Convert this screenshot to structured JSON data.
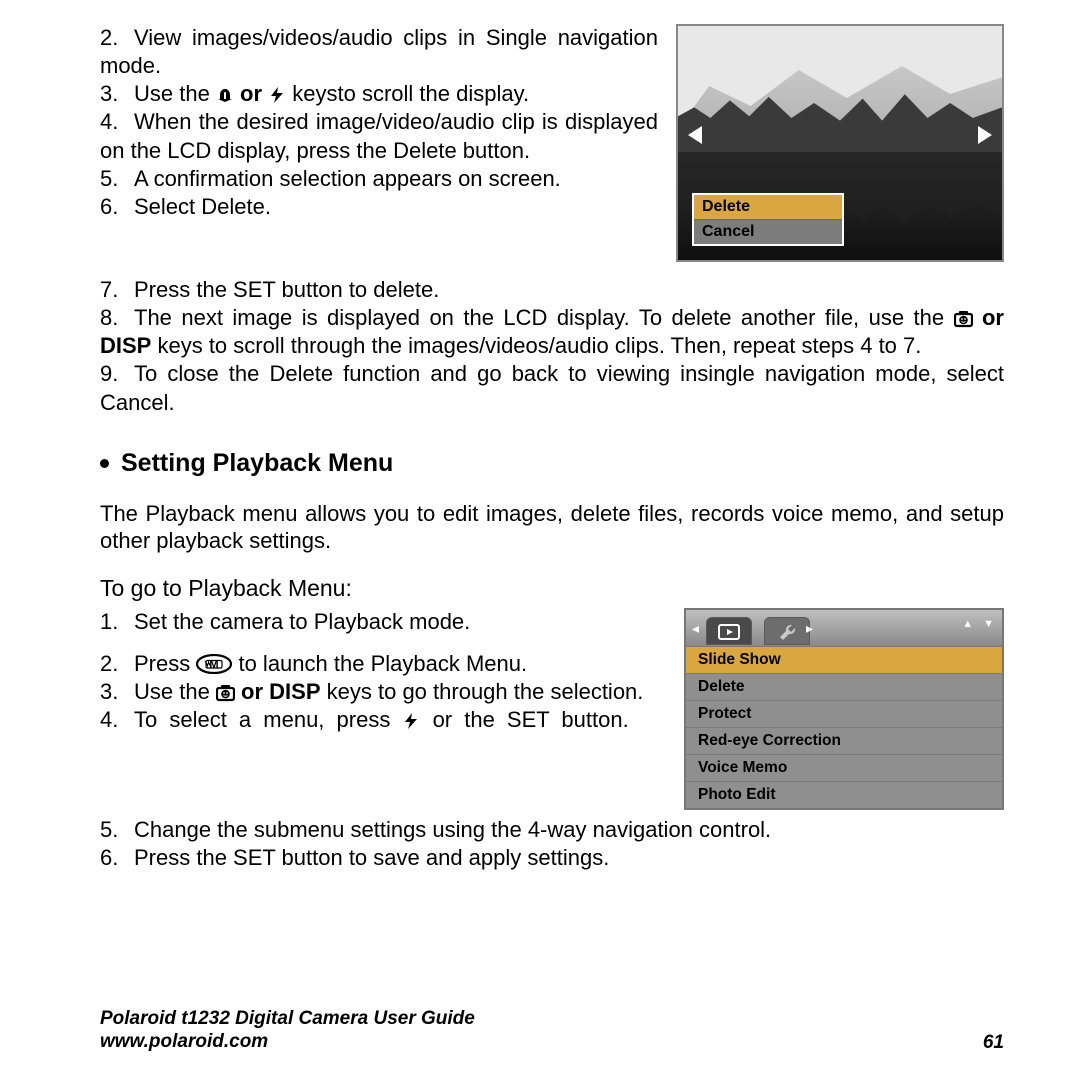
{
  "steps_top": [
    {
      "n": "2.",
      "text_before": "View images/videos/audio clips in Single navigation mode."
    },
    {
      "n": "3.",
      "text_before": "Use the ",
      "icon1": "macro-icon",
      "mid": " or ",
      "icon2": "flash-icon",
      "text_after": " keysto scroll the display."
    },
    {
      "n": "4.",
      "text_before": "When the desired image/video/audio clip is displayed on the LCD display, press the Delete button."
    },
    {
      "n": "5.",
      "text_before": "A confirmation selection appears on screen."
    },
    {
      "n": "6.",
      "text_before": "Select Delete."
    }
  ],
  "steps_mid": [
    {
      "n": "7.",
      "text_before": "Press the SET button to delete."
    },
    {
      "n": "8.",
      "text_before": "The next image is displayed on the LCD display. To delete another file, use the ",
      "icon1": "face-frame-icon",
      "mid": " or ",
      "key": "DISP",
      "text_after": " keys to scroll through the images/videos/audio clips. Then, repeat steps 4 to 7."
    },
    {
      "n": "9.",
      "text_before": "To close the Delete function and go back to viewing insingle navigation mode, select Cancel."
    }
  ],
  "dialog": {
    "delete": "Delete",
    "cancel": "Cancel"
  },
  "section_heading": "Setting Playback Menu",
  "section_para": "The Playback menu allows you to edit images, delete files, records voice memo, and setup other playback settings.",
  "section_sub": "To go to Playback Menu:",
  "pb_steps_left": [
    {
      "n": "1.",
      "text_before": "Set the camera to Playback mode."
    },
    {
      "n": "2.",
      "text_before": "Press ",
      "icon1": "menu-oval-icon",
      "text_after": " to launch the Playback Menu."
    },
    {
      "n": "3.",
      "text_before": "Use the ",
      "icon1": "face-frame-icon",
      "mid": " or ",
      "key": "DISP",
      "text_after": " keys to go through the selection."
    },
    {
      "n": "4.",
      "text_before": "To select a menu, press ",
      "icon1": "flash-icon",
      "text_after2": " or the SET button."
    }
  ],
  "pb_steps_bottom": [
    {
      "n": "5.",
      "text_before": "Change the submenu settings using the 4-way navigation control."
    },
    {
      "n": "6.",
      "text_before": "Press the SET button to save and apply settings."
    }
  ],
  "menu_items": [
    "Slide Show",
    "Delete",
    "Protect",
    "Red-eye Correction",
    "Voice Memo",
    "Photo Edit"
  ],
  "footer": {
    "title": "Polaroid t1232 Digital Camera User Guide",
    "url": "www.polaroid.com",
    "page": "61"
  },
  "disp_label": "DISP"
}
